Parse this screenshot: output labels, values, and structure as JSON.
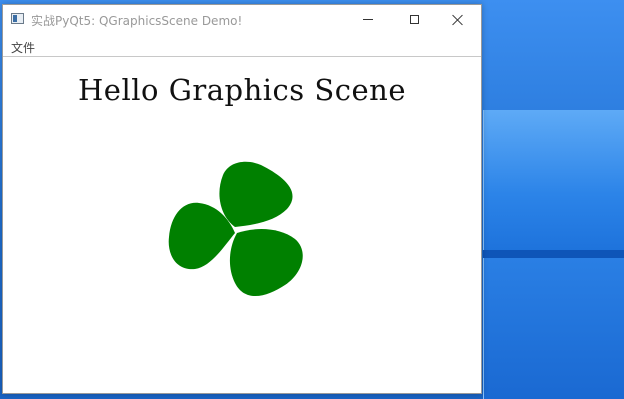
{
  "window": {
    "title": "实战PyQt5: QGraphicsScene Demo!",
    "icon": "app-window-icon",
    "controls": {
      "minimize_icon": "minimize-icon",
      "maximize_icon": "maximize-icon",
      "close_icon": "close-icon"
    }
  },
  "menubar": {
    "items": [
      {
        "label": "文件"
      }
    ]
  },
  "scene": {
    "title": "Hello Graphics Scene",
    "shape": {
      "name": "clover-shape",
      "color": "#008000"
    }
  },
  "colors": {
    "desktop_blue": "#1f6fd1",
    "window_bg": "#ffffff",
    "clover_green": "#008000"
  }
}
